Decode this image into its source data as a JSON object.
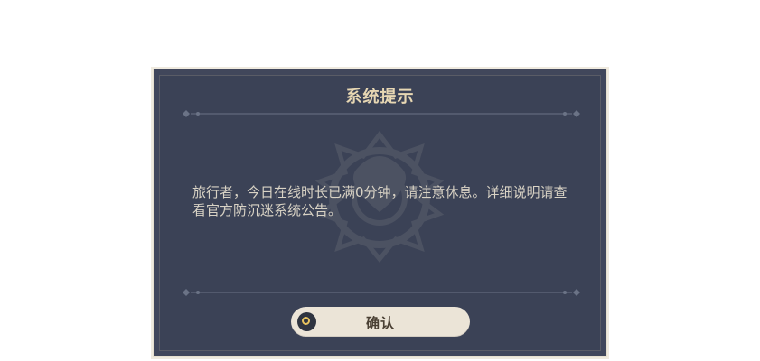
{
  "dialog": {
    "title": "系统提示",
    "message": "旅行者，今日在线时长已满0分钟，请注意休息。详细说明请查看官方防沉迷系统公告。",
    "confirm_label": "确认"
  },
  "colors": {
    "panel": "#3b4256",
    "title": "#e7d7b3",
    "button": "#ebe4d7",
    "accent": "#e8c35f"
  },
  "icons": {
    "confirm": "circle-confirm-icon",
    "corner": "star-ornament-icon",
    "emblem": "decorative-emblem-icon"
  }
}
